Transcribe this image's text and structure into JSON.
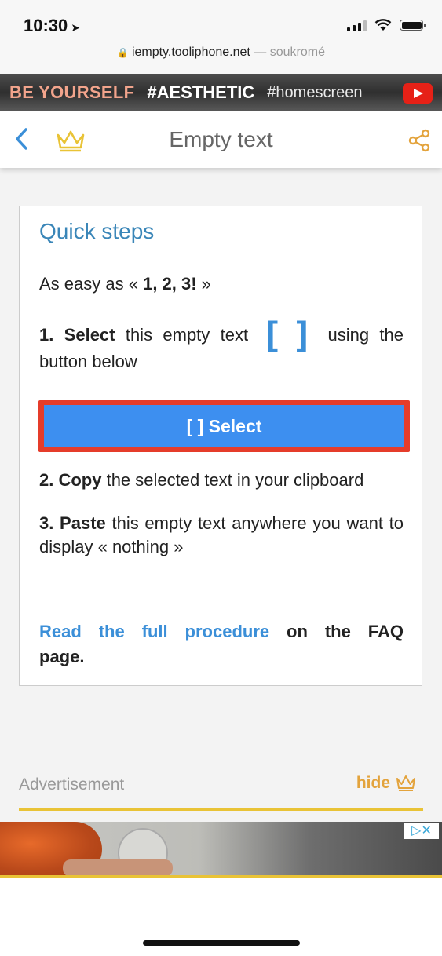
{
  "status_bar": {
    "time": "10:30",
    "location_glyph": "➤"
  },
  "browser": {
    "domain": "iempty.tooliphone.net",
    "separator": " — ",
    "mode": "soukromé"
  },
  "banner": {
    "part1": "BE YOURSELF",
    "part2": "#AESTHETIC",
    "part3": "#homescreen"
  },
  "header": {
    "title": "Empty text"
  },
  "card": {
    "heading": "Quick steps",
    "easy_prefix": "As easy as « ",
    "easy_bold": "1, 2, 3!",
    "easy_suffix": " »",
    "step1_bold": "1. Select",
    "step1_text": " this empty text ",
    "step1_bracket": "[ ]",
    "step1_tail": " using the button below",
    "select_button": "[ ] Select",
    "step2_bold": "2. Copy",
    "step2_text": " the selected text in your clipboard",
    "step3_bold": "3. Paste",
    "step3_text": " this empty text anywhere you want to display « nothing »",
    "faq_link": "Read the full procedure",
    "faq_tail": " on the FAQ page."
  },
  "ad": {
    "label": "Advertisement",
    "hide": "hide",
    "adchoice": "▷✕"
  },
  "colors": {
    "accent_blue": "#3b8fd8",
    "button_blue": "#3d8ff0",
    "highlight_red": "#e53c2a",
    "gold": "#e3a33c"
  }
}
